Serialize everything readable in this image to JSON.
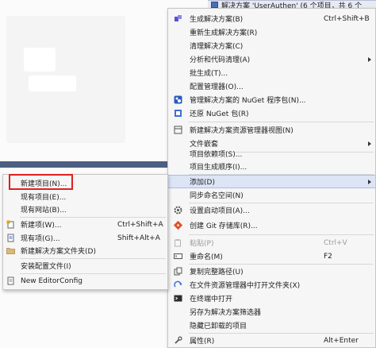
{
  "solution_explorer": {
    "node_label": "解决方案 'UserAuthen' (6 个项目，共 6 个"
  },
  "main_menu": {
    "items": [
      {
        "label": "生成解决方案(B)",
        "shortcut": "Ctrl+Shift+B",
        "icon": "build-icon"
      },
      {
        "label": "重新生成解决方案(R)",
        "shortcut": "",
        "icon": ""
      },
      {
        "label": "清理解决方案(C)",
        "shortcut": "",
        "icon": ""
      },
      {
        "label": "分析和代码清理(A)",
        "shortcut": "",
        "icon": ""
      },
      {
        "label": "批生成(T)...",
        "shortcut": "",
        "icon": ""
      },
      {
        "label": "配置管理器(O)...",
        "shortcut": "",
        "icon": ""
      },
      {
        "label": "管理解决方案的 NuGet 程序包(N)...",
        "shortcut": "",
        "icon": "nuget-icon"
      },
      {
        "label": "还原 NuGet 包(R)",
        "shortcut": "",
        "icon": "restore-icon"
      },
      {
        "label": "新建解决方案资源管理器视图(N)",
        "shortcut": "",
        "icon": "new-view-icon"
      },
      {
        "label": "文件嵌套",
        "shortcut": "",
        "icon": ""
      },
      {
        "label": "项目依赖项(S)...",
        "shortcut": "",
        "icon": ""
      },
      {
        "label": "项目生成顺序(I)...",
        "shortcut": "",
        "icon": ""
      },
      {
        "label": "添加(D)",
        "shortcut": "",
        "icon": ""
      },
      {
        "label": "同步命名空间(N)",
        "shortcut": "",
        "icon": ""
      },
      {
        "label": "设置启动项目(A)...",
        "shortcut": "",
        "icon": "gear-icon"
      },
      {
        "label": "创建 Git 存储库(R)...",
        "shortcut": "",
        "icon": "git-icon"
      },
      {
        "label": "粘贴(P)",
        "shortcut": "Ctrl+V",
        "icon": "paste-icon"
      },
      {
        "label": "重命名(M)",
        "shortcut": "F2",
        "icon": "rename-icon"
      },
      {
        "label": "复制完整路径(U)",
        "shortcut": "",
        "icon": "copy-path-icon"
      },
      {
        "label": "在文件资源管理器中打开文件夹(X)",
        "shortcut": "",
        "icon": "open-folder-icon"
      },
      {
        "label": "在终端中打开",
        "shortcut": "",
        "icon": "terminal-icon"
      },
      {
        "label": "另存为解决方案筛选器",
        "shortcut": "",
        "icon": ""
      },
      {
        "label": "隐藏已卸载的项目",
        "shortcut": "",
        "icon": ""
      },
      {
        "label": "属性(R)",
        "shortcut": "Alt+Enter",
        "icon": "wrench-icon"
      }
    ]
  },
  "sub_menu": {
    "items": [
      {
        "label": "新建项目(N)...",
        "shortcut": "",
        "icon": ""
      },
      {
        "label": "现有项目(E)...",
        "shortcut": "",
        "icon": ""
      },
      {
        "label": "现有网站(B)...",
        "shortcut": "",
        "icon": ""
      },
      {
        "label": "新建项(W)...",
        "shortcut": "Ctrl+Shift+A",
        "icon": "new-item-icon"
      },
      {
        "label": "现有项(G)...",
        "shortcut": "Shift+Alt+A",
        "icon": "existing-item-icon"
      },
      {
        "label": "新建解决方案文件夹(D)",
        "shortcut": "",
        "icon": "folder-icon"
      },
      {
        "label": "安装配置文件(I)",
        "shortcut": "",
        "icon": ""
      },
      {
        "label": "New EditorConfig",
        "shortcut": "",
        "icon": "editorconfig-icon"
      }
    ]
  }
}
